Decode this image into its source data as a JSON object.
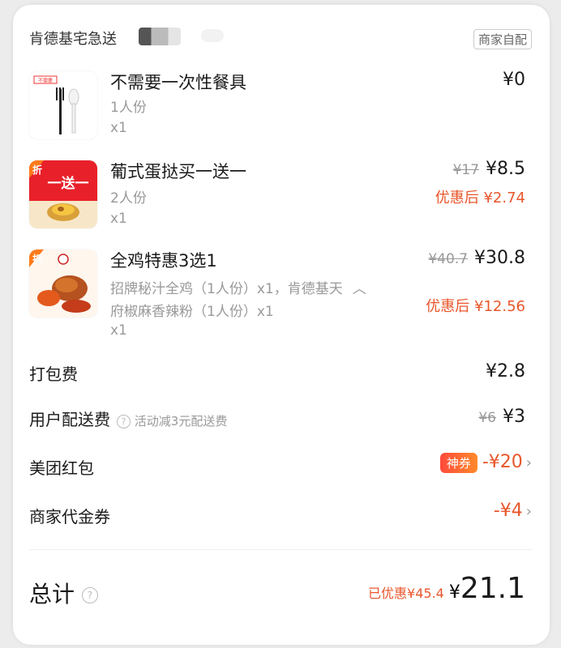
{
  "header": {
    "shop_name": "肯德基宅急送",
    "delivery_badge": "商家自配"
  },
  "items": [
    {
      "name": "不需要一次性餐具",
      "portion": "1人份",
      "qty": "x1",
      "price": "¥0",
      "thumb_tag": "不需要"
    },
    {
      "name": "葡式蛋挞买一送一",
      "portion": "2人份",
      "qty": "x1",
      "original_price": "¥17",
      "price": "¥8.5",
      "after_discount": "优惠后 ¥2.74",
      "thumb_tag": "折",
      "thumb_banner": "一送一"
    },
    {
      "name": "全鸡特惠3选1",
      "detail_line1": "招牌秘汁全鸡（1人份）x1，肯德基天",
      "detail_line2": "府椒麻香辣粉（1人份）x1",
      "qty": "x1",
      "original_price": "¥40.7",
      "price": "¥30.8",
      "after_discount": "优惠后 ¥12.56",
      "thumb_tag": "折"
    }
  ],
  "fees": {
    "packing": {
      "label": "打包费",
      "value": "¥2.8"
    },
    "delivery": {
      "label": "用户配送费",
      "note": "活动减3元配送费",
      "original": "¥6",
      "value": "¥3"
    },
    "red_packet": {
      "label": "美团红包",
      "tag": "神券",
      "value": "-¥20"
    },
    "voucher": {
      "label": "商家代金券",
      "value": "-¥4"
    }
  },
  "total": {
    "label": "总计",
    "saved": "已优惠¥45.4",
    "currency": "¥",
    "amount": "21.1"
  },
  "colors": {
    "accent": "#e8562b",
    "muted": "#999999"
  }
}
